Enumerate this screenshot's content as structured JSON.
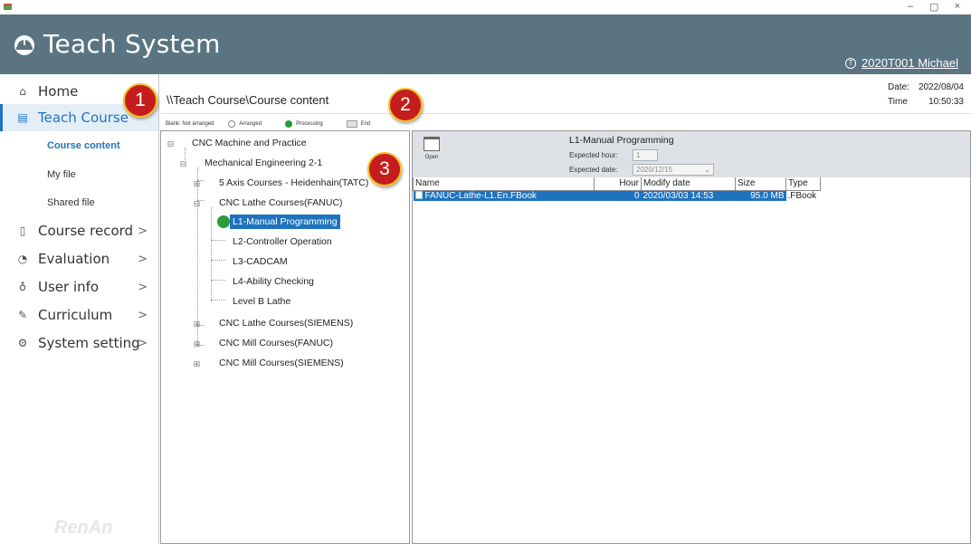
{
  "window": {
    "minimize": "–",
    "restore": "▢",
    "close": "×"
  },
  "header": {
    "title": "Teach System",
    "user": "2020T001 Michael",
    "user_icon_glyph": "T"
  },
  "sidebar": {
    "items": [
      {
        "label": "Home",
        "icon": "home-icon",
        "glyph": "⌂",
        "chevron": ""
      },
      {
        "label": "Teach Course",
        "icon": "book-icon",
        "glyph": "▤",
        "chevron": ""
      },
      {
        "label": "Course record",
        "icon": "record-icon",
        "glyph": "▯",
        "chevron": ">"
      },
      {
        "label": "Evaluation",
        "icon": "evaluation-icon",
        "glyph": "◔",
        "chevron": ">"
      },
      {
        "label": "User info",
        "icon": "user-icon",
        "glyph": "♁",
        "chevron": ">"
      },
      {
        "label": "Curriculum",
        "icon": "pencil-icon",
        "glyph": "✎",
        "chevron": ">"
      },
      {
        "label": "System setting",
        "icon": "settings-icon",
        "glyph": "⚙",
        "chevron": ">"
      }
    ],
    "sub_items": [
      "Course content",
      "My file",
      "Shared file"
    ],
    "brand": "RenAn"
  },
  "path": "\\\\Teach Course\\Course content",
  "datetime": {
    "date_label": "Date:",
    "date": "2022/08/04",
    "time_label": "Time",
    "time": "10:50:33"
  },
  "legend": {
    "blank": "Blank: Not arranged",
    "arranged": "Arranged",
    "processing": "Processing",
    "end": "End"
  },
  "tree": {
    "root": "CNC Machine and Practice",
    "group": "Mechanical Engineering 2-1",
    "course1": "5 Axis Courses - Heidenhain(TATC)",
    "course2": "CNC Lathe Courses(FANUC)",
    "lessons": [
      "L1-Manual Programming",
      "L2-Controller Operation",
      "L3-CADCAM",
      "L4-Ability Checking",
      "Level B Lathe"
    ],
    "course3": "CNC Lathe Courses(SIEMENS)",
    "course4": "CNC Mill Courses(FANUC)",
    "course5": "CNC Mill Courses(SIEMENS)",
    "expand": "⊞",
    "collapse": "⊟"
  },
  "detail": {
    "open_label": "Open",
    "title": "L1-Manual Programming",
    "expected_hour_label": "Expected hour:",
    "expected_hour": "1",
    "expected_date_label": "Expected date:",
    "expected_date": "2020/12/15",
    "dropdown_glyph": "⌄"
  },
  "files": {
    "columns": [
      "Name",
      "Hour",
      "Modify date",
      "Size",
      "Type"
    ],
    "rows": [
      {
        "name": "FANUC-Lathe-L1.En.FBook",
        "hour": "0",
        "date": "2020/03/03 14:53",
        "size": "95.0 MB",
        "type": ".FBook"
      }
    ]
  },
  "callouts": [
    "1",
    "2",
    "3"
  ],
  "colors": {
    "header_bg": "#5a7481",
    "accent": "#1e73be",
    "callout_red": "#c51d1d",
    "callout_border": "#f2c21b",
    "processing_green": "#2a9d3a"
  }
}
